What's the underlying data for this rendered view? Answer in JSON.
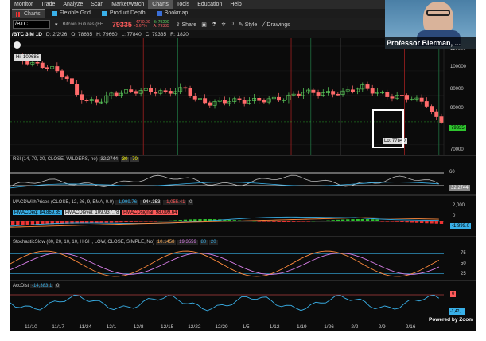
{
  "menu": [
    "Monitor",
    "Trade",
    "Analyze",
    "Scan",
    "MarketWatch",
    "Charts",
    "Tools",
    "Education",
    "Help"
  ],
  "menu_active": "Charts",
  "tabs": [
    {
      "label": "Charts",
      "icon": "bar-chart-icon"
    },
    {
      "label": "Flexible Grid",
      "icon": "grid-icon"
    },
    {
      "label": "Product Depth",
      "icon": "depth-icon"
    },
    {
      "label": "Bookmap",
      "icon": "bookmap-icon"
    }
  ],
  "toolbar": {
    "symbol": "/BTC",
    "desc": "Bitcoin Futures (FE...",
    "price": "79335",
    "change_top": "-4770.00",
    "change_bottom": "-5.67%",
    "bid": "B: 79290",
    "ask": "A: 79335",
    "share": "Share",
    "style": "Style",
    "drawings": "Drawings",
    "counter": "0"
  },
  "ohlc": {
    "symbol_tf": "/BTC 3 M 1D",
    "date": "D: 2/2/26",
    "open": "O: 78635",
    "high": "H: 79660",
    "low": "L: 77840",
    "close": "C: 79335",
    "range": "R: 1820"
  },
  "price_panel": {
    "hi_label": "Hi: 109685",
    "lo_label": "Lo: 77840",
    "last_price": "79335",
    "y_ticks": [
      "110000",
      "100000",
      "90000",
      "80000",
      "70000"
    ],
    "vlabels": [
      "11/26/25",
      "12/24/25",
      "12/24/25",
      "1/20/26",
      "2/2/26"
    ]
  },
  "rsi": {
    "label": "RSI (14, 70, 30, CLOSE, WILDERS, no)",
    "value": "32.2744",
    "ob": "30",
    "os": "70",
    "y_ticks": [
      "80",
      "60",
      "40",
      "20"
    ],
    "last": "32.2744"
  },
  "macd": {
    "label": "MACDWithPrices (CLOSE, 12, 26, 9, EMA, 0.0)",
    "v1": "-1,999.76",
    "v2": "-944.353",
    "v3": "-1,055.41",
    "v4": "0",
    "deq": "PMACDeq: 84,869.35",
    "dlevel": "PMACDlevel: 109,937.78",
    "dsignal": "PMACDsignal: 98,099.64",
    "y_ticks": [
      "2,000",
      "0"
    ],
    "last": "-1,999.0"
  },
  "stoch": {
    "label": "StochasticSlow (80, 20, 10, 10, HIGH, LOW, CLOSE, SIMPLE, No)",
    "v1": "10.1458",
    "v2": "19.3559",
    "v3": "80",
    "v4": "20",
    "y_ticks": [
      "75",
      "50",
      "25"
    ]
  },
  "accdist": {
    "label": "AccDist",
    "value": "-14,383.1",
    "v2": "0",
    "y_ticks": [
      "0"
    ],
    "last": "-1,42,..."
  },
  "xaxis": [
    "11/10",
    "11/17",
    "11/24",
    "12/1",
    "12/8",
    "12/15",
    "12/22",
    "12/29",
    "1/5",
    "1/12",
    "1/19",
    "1/26",
    "2/2",
    "2/9",
    "2/16"
  ],
  "webcam_name": "Professor Bierman, ...",
  "zoom_wm": "Powered by Zoom",
  "colors": {
    "up": "#5fd35f",
    "down": "#ff6b6b",
    "bg": "#0b0b0b",
    "accent": "#39b0e8"
  }
}
